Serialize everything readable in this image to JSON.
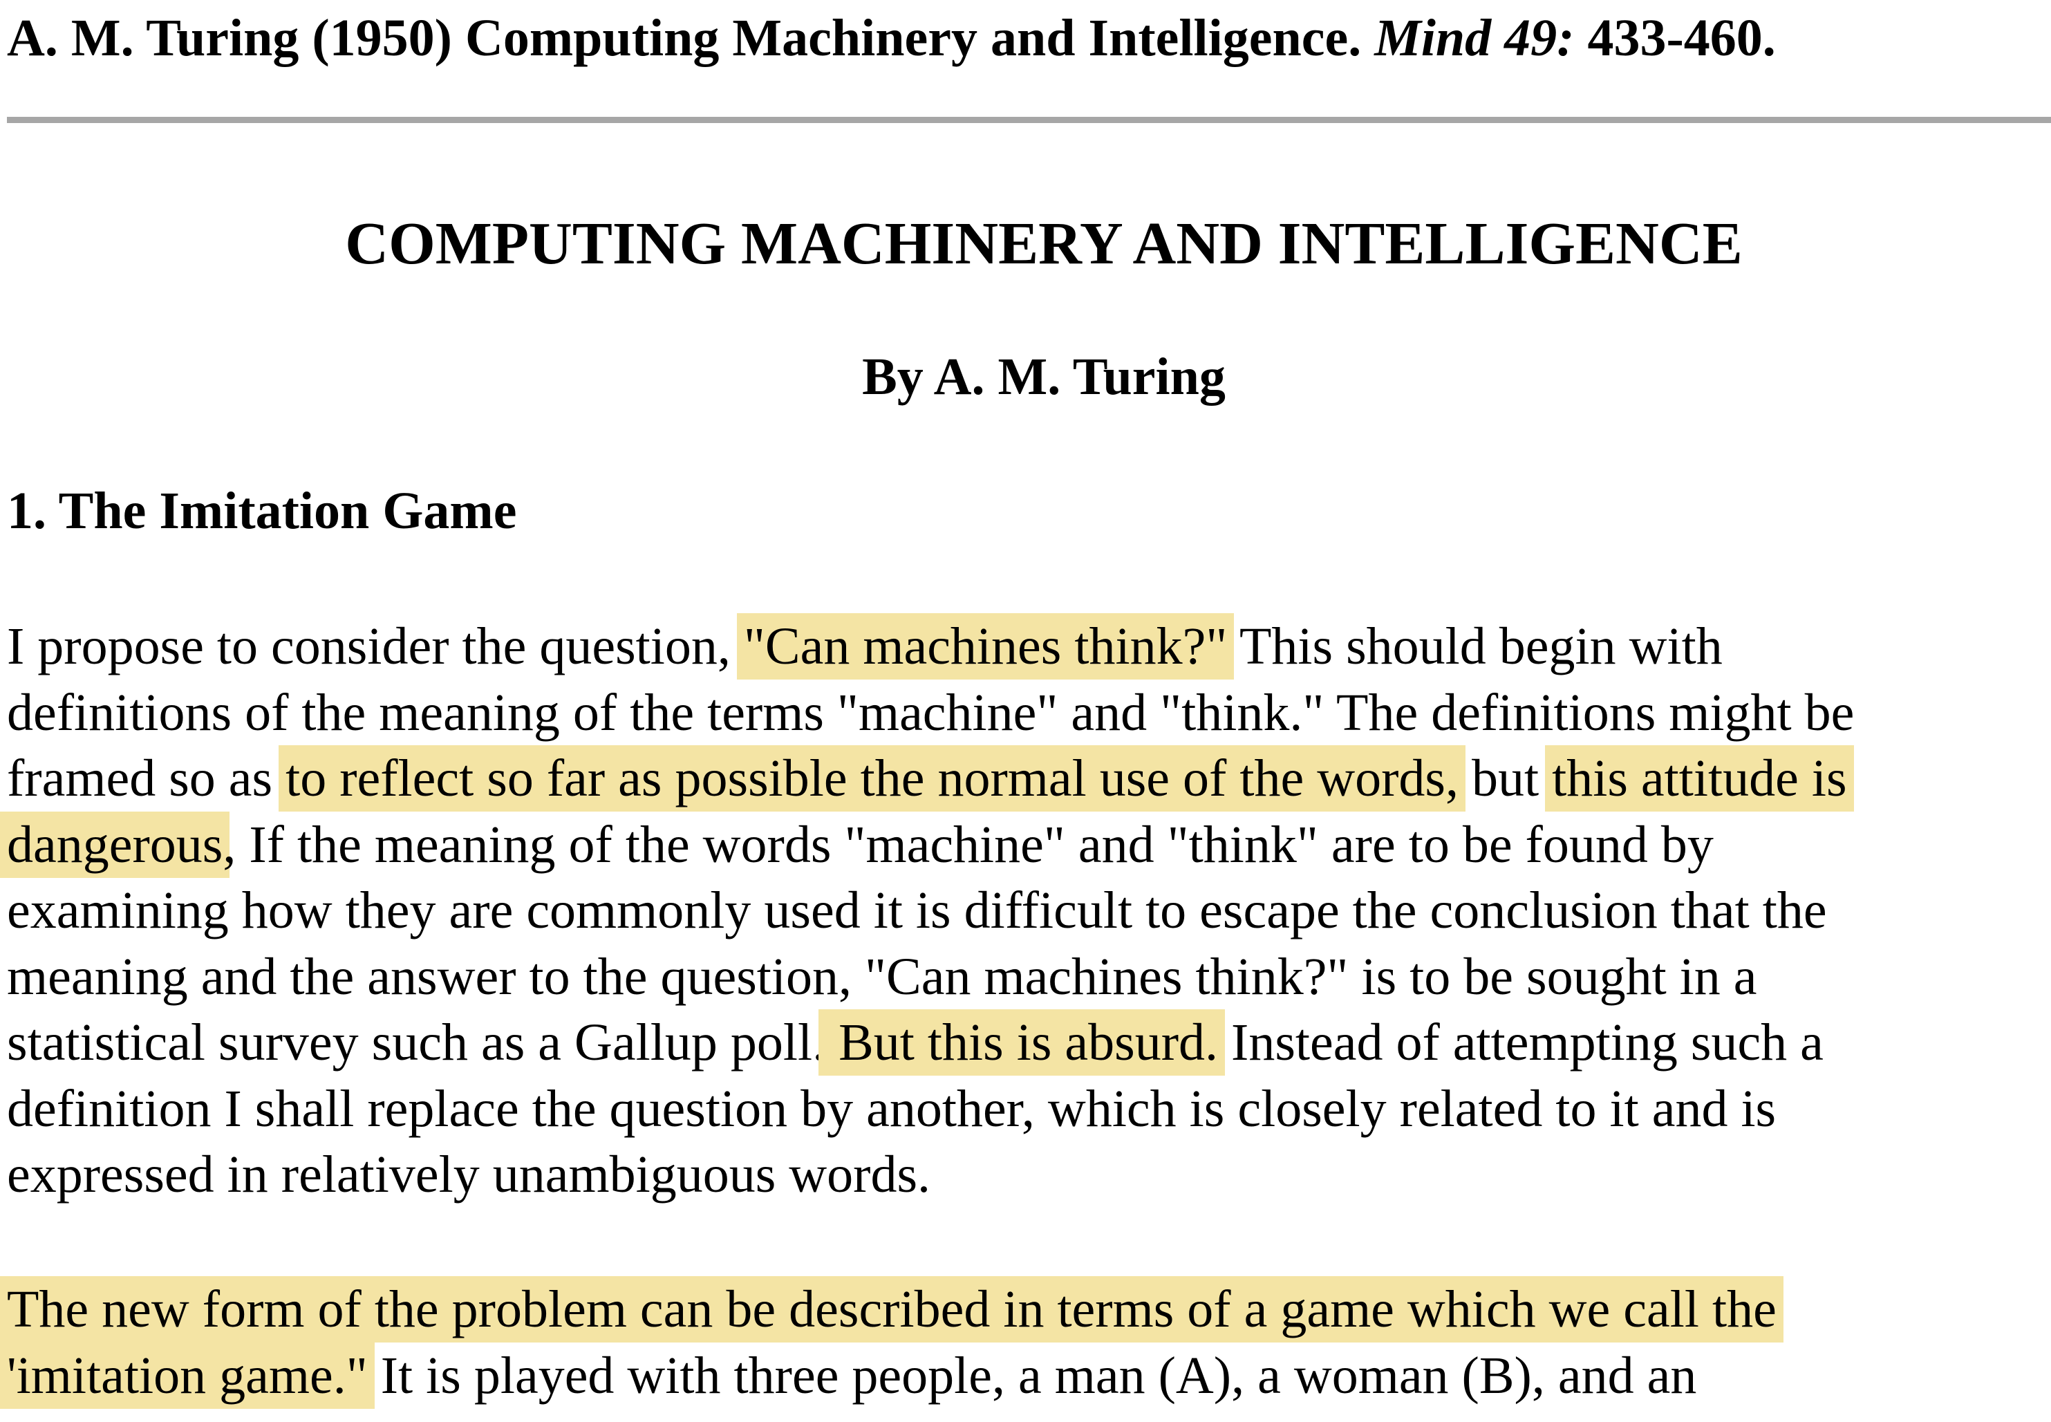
{
  "citation": {
    "prefix": "A. M. Turing (1950) Computing Machinery and Intelligence.",
    "journal": "Mind 49:",
    "pages": "433-460."
  },
  "title": "COMPUTING MACHINERY AND INTELLIGENCE",
  "byline": "By A. M. Turing",
  "section_heading": "1. The Imitation Game",
  "highlight_color": "#f4e4a4",
  "paragraph1": {
    "l1_a": "I propose to consider the question, ",
    "l1_hl": "\"Can machines think?\"",
    "l1_b": " This should begin with",
    "l2": "definitions of the meaning of the terms \"machine\" and \"think.\" The definitions might be",
    "l3_a": "framed so as ",
    "l3_hl1": "to reflect so far as possible the normal use of the words,",
    "l3_b": " but ",
    "l3_hl2": "this attitude is",
    "l4_hl": "dangerous",
    "l4_b": ", If the meaning of the words \"machine\" and \"think\" are to be found by",
    "l5": "examining how they are commonly used it is difficult to escape the conclusion that the",
    "l6": "meaning and the answer to the question, \"Can machines think?\" is to be sought in a",
    "l7_a": "statistical survey such as a Gallup poll.",
    "l7_hl": " But this is absurd.",
    "l7_b": " Instead of attempting such a",
    "l8": "definition I shall replace the question by another, which is closely related to it and is",
    "l9": "expressed in relatively unambiguous words."
  },
  "paragraph2": {
    "l1_hl": "The new form of the problem can be described in terms of a game which we call the",
    "l2_hl": "'imitation game.\"",
    "l2_b": " It is played with three people, a man (A), a woman (B), and an"
  }
}
